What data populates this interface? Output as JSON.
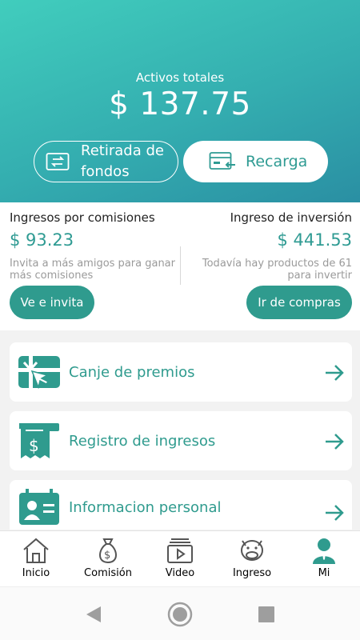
{
  "header": {
    "assets_label": "Activos totales",
    "assets_value": "$ 137.75",
    "withdraw_line1": "Retirada de",
    "withdraw_line2": "fondos",
    "recharge_label": "Recarga"
  },
  "earnings": {
    "commission": {
      "title": "Ingresos por comisiones",
      "amount": "$ 93.23",
      "desc": "Invita a más amigos para ganar más comisiones",
      "action": "Ve e invita"
    },
    "investment": {
      "title": "Ingreso de inversión",
      "amount": "$ 441.53",
      "desc_line1": "Todavía hay productos de 61",
      "desc_line2": "para invertir",
      "action": "Ir de compras"
    }
  },
  "menu": [
    {
      "label": "Canje de premios",
      "icon": "gift-card-icon"
    },
    {
      "label": "Registro de ingresos",
      "icon": "receipt-icon"
    },
    {
      "label": "Informacion personal",
      "icon": "id-card-icon"
    }
  ],
  "tabbar": {
    "items": [
      {
        "label": "Inicio",
        "icon": "home-icon"
      },
      {
        "label": "Comisión",
        "icon": "money-bag-icon"
      },
      {
        "label": "Video",
        "icon": "video-icon"
      },
      {
        "label": "Ingreso",
        "icon": "cow-icon"
      },
      {
        "label": "Mi",
        "icon": "person-icon",
        "active": true
      }
    ]
  },
  "colors": {
    "accent": "#2f9b8e",
    "gradient_start": "#41cdbd",
    "gradient_end": "#2a8fa3"
  }
}
